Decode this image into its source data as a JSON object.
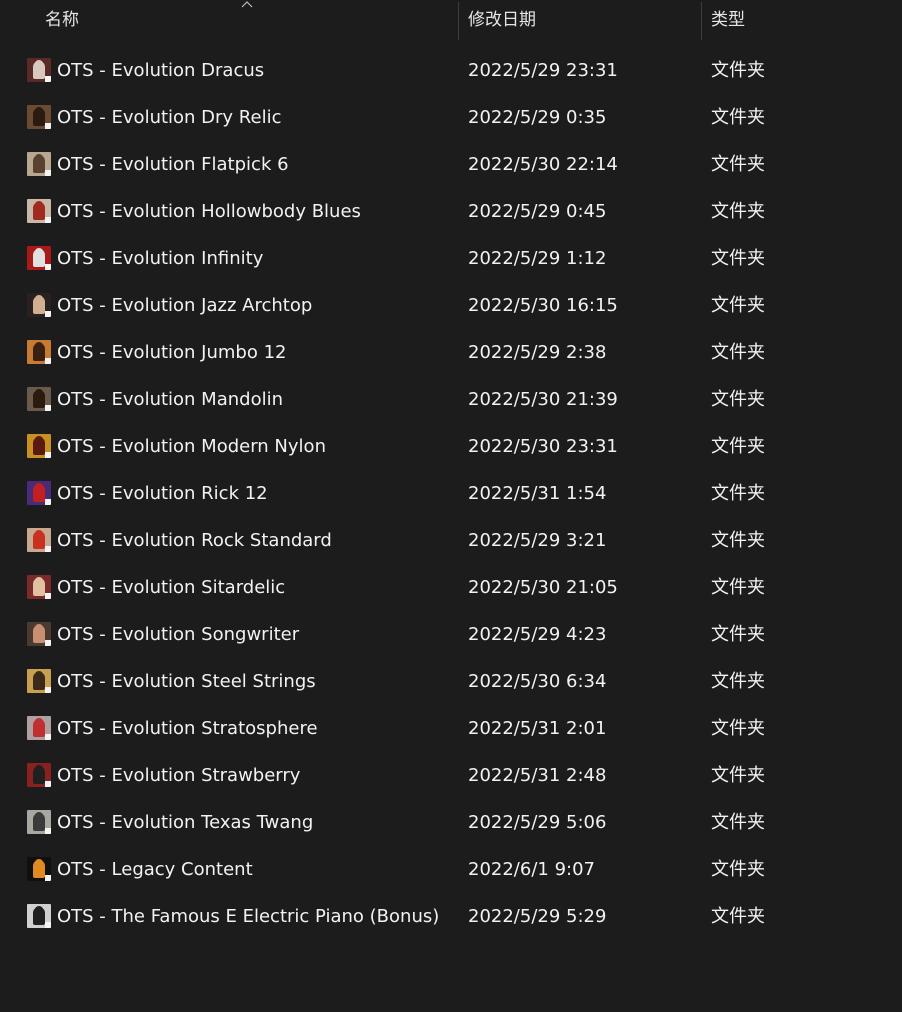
{
  "columns": {
    "name": "名称",
    "date": "修改日期",
    "type": "类型"
  },
  "items": [
    {
      "name": "OTS - Evolution Dracus",
      "date": "2022/5/29 23:31",
      "type": "文件夹",
      "icon": "folder-thumbnail-icon",
      "bg": "#5a2a26",
      "fg": "#d8c8c0"
    },
    {
      "name": "OTS - Evolution Dry Relic",
      "date": "2022/5/29 0:35",
      "type": "文件夹",
      "icon": "folder-thumbnail-icon",
      "bg": "#6a4a30",
      "fg": "#2a1a10"
    },
    {
      "name": "OTS - Evolution Flatpick 6",
      "date": "2022/5/30 22:14",
      "type": "文件夹",
      "icon": "folder-thumbnail-icon",
      "bg": "#b8a890",
      "fg": "#5a4030"
    },
    {
      "name": "OTS - Evolution Hollowbody Blues",
      "date": "2022/5/29 0:45",
      "type": "文件夹",
      "icon": "folder-thumbnail-icon",
      "bg": "#c8b8a8",
      "fg": "#a02a20"
    },
    {
      "name": "OTS - Evolution Infinity",
      "date": "2022/5/29 1:12",
      "type": "文件夹",
      "icon": "folder-thumbnail-icon",
      "bg": "#a81a1a",
      "fg": "#e0e0e0"
    },
    {
      "name": "OTS - Evolution Jazz Archtop",
      "date": "2022/5/30 16:15",
      "type": "文件夹",
      "icon": "folder-thumbnail-icon",
      "bg": "#2a2020",
      "fg": "#d0b090"
    },
    {
      "name": "OTS - Evolution Jumbo 12",
      "date": "2022/5/29 2:38",
      "type": "文件夹",
      "icon": "folder-thumbnail-icon",
      "bg": "#c87a30",
      "fg": "#3a2010"
    },
    {
      "name": "OTS - Evolution Mandolin",
      "date": "2022/5/30 21:39",
      "type": "文件夹",
      "icon": "folder-thumbnail-icon",
      "bg": "#6a5a4a",
      "fg": "#2a1a10"
    },
    {
      "name": "OTS - Evolution Modern Nylon",
      "date": "2022/5/30 23:31",
      "type": "文件夹",
      "icon": "folder-thumbnail-icon",
      "bg": "#c89020",
      "fg": "#5a1a10"
    },
    {
      "name": "OTS - Evolution Rick 12",
      "date": "2022/5/31 1:54",
      "type": "文件夹",
      "icon": "folder-thumbnail-icon",
      "bg": "#4a2a7a",
      "fg": "#c02020"
    },
    {
      "name": "OTS - Evolution Rock Standard",
      "date": "2022/5/29 3:21",
      "type": "文件夹",
      "icon": "folder-thumbnail-icon",
      "bg": "#c8a890",
      "fg": "#c83020"
    },
    {
      "name": "OTS - Evolution Sitardelic",
      "date": "2022/5/30 21:05",
      "type": "文件夹",
      "icon": "folder-thumbnail-icon",
      "bg": "#7a2a2a",
      "fg": "#e0c0a0"
    },
    {
      "name": "OTS - Evolution Songwriter",
      "date": "2022/5/29 4:23",
      "type": "文件夹",
      "icon": "folder-thumbnail-icon",
      "bg": "#4a3a30",
      "fg": "#c89070"
    },
    {
      "name": "OTS - Evolution Steel Strings",
      "date": "2022/5/30 6:34",
      "type": "文件夹",
      "icon": "folder-thumbnail-icon",
      "bg": "#c8a050",
      "fg": "#3a2a1a"
    },
    {
      "name": "OTS - Evolution Stratosphere",
      "date": "2022/5/31 2:01",
      "type": "文件夹",
      "icon": "folder-thumbnail-icon",
      "bg": "#b0a0a0",
      "fg": "#c03030"
    },
    {
      "name": "OTS - Evolution Strawberry",
      "date": "2022/5/31 2:48",
      "type": "文件夹",
      "icon": "folder-thumbnail-icon",
      "bg": "#8a2020",
      "fg": "#202020"
    },
    {
      "name": "OTS - Evolution Texas Twang",
      "date": "2022/5/29 5:06",
      "type": "文件夹",
      "icon": "folder-thumbnail-icon",
      "bg": "#a8a8a0",
      "fg": "#3a3a3a"
    },
    {
      "name": "OTS - Legacy Content",
      "date": "2022/6/1 9:07",
      "type": "文件夹",
      "icon": "folder-thumbnail-icon",
      "bg": "#101010",
      "fg": "#e08a20"
    },
    {
      "name": "OTS - The Famous E Electric Piano (Bonus)",
      "date": "2022/5/29 5:29",
      "type": "文件夹",
      "icon": "folder-thumbnail-icon",
      "bg": "#d0d0d0",
      "fg": "#202020"
    }
  ]
}
